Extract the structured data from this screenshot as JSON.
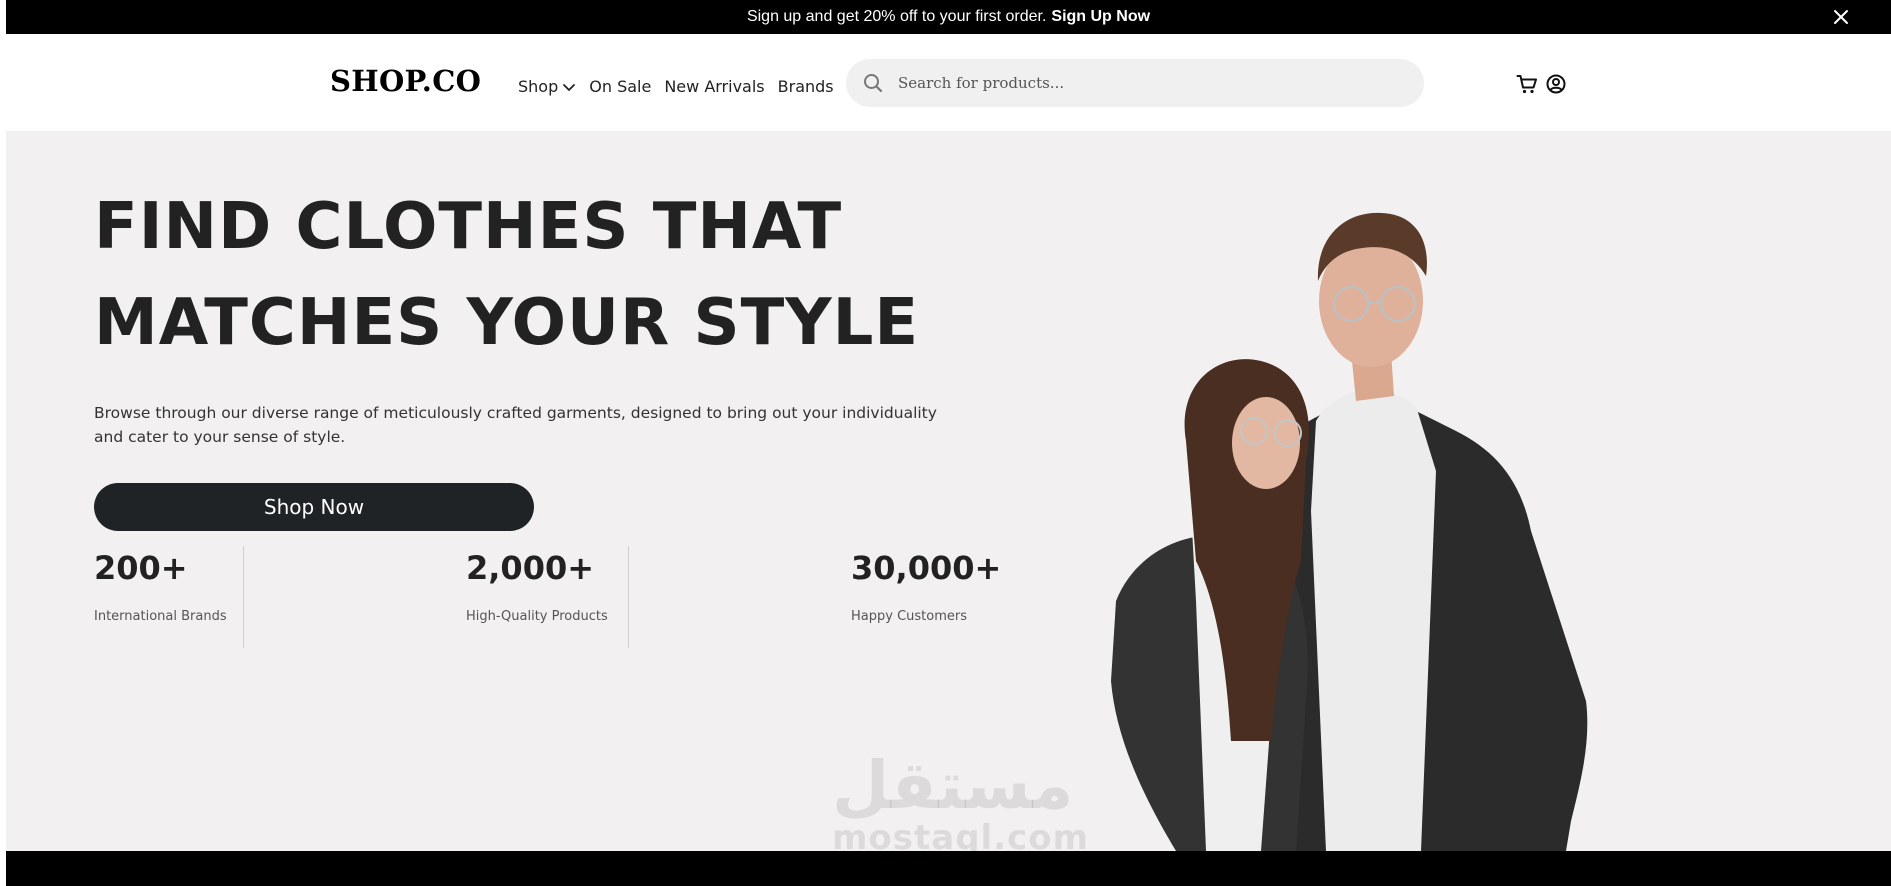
{
  "announcement": {
    "text": "Sign up and get 20% off to your first order.",
    "cta": "Sign Up Now",
    "close_icon": "close-icon"
  },
  "header": {
    "logo": "SHOP.CO",
    "nav": [
      {
        "label": "Shop",
        "has_dropdown": true
      },
      {
        "label": "On Sale"
      },
      {
        "label": "New Arrivals"
      },
      {
        "label": "Brands"
      }
    ],
    "search": {
      "placeholder": "Search for products...",
      "icon": "search-icon"
    },
    "icons": [
      "cart-icon",
      "account-icon"
    ]
  },
  "hero": {
    "headline_line1": "FIND CLOTHES THAT",
    "headline_line2": "MATCHES YOUR STYLE",
    "description": "Browse through our diverse range of meticulously crafted garments, designed to bring out your individuality and cater to your sense of style.",
    "button": "Shop Now",
    "stats": [
      {
        "value": "200+",
        "label": "International Brands"
      },
      {
        "value": "2,000+",
        "label": "High-Quality Products"
      },
      {
        "value": "30,000+",
        "label": "Happy Customers"
      }
    ]
  },
  "watermark": {
    "arabic": "مستقل",
    "latin": "mostaql.com"
  },
  "colors": {
    "topbar_bg": "#000000",
    "hero_bg": "#f2f0f1",
    "button_bg": "#202326",
    "search_bg": "#f0f0f0"
  }
}
